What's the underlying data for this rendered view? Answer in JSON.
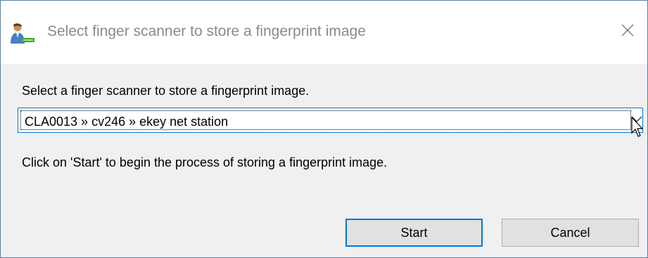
{
  "window": {
    "title": "Select finger scanner to store a fingerprint image",
    "app_icon": "user-scanner-icon",
    "close_icon": "close-icon"
  },
  "dialog": {
    "instruction": "Select a finger scanner to store a fingerprint image.",
    "scanner_select": {
      "selected_value": "CLA0013 » cv246 » ekey net station",
      "arrow_icon": "chevron-down-icon"
    },
    "hint": "Click on 'Start' to begin the process of storing a fingerprint image.",
    "buttons": {
      "start_label": "Start",
      "cancel_label": "Cancel"
    }
  },
  "colors": {
    "accent": "#0078d7",
    "dialog_background": "#f0f0f0",
    "button_background": "#e1e1e1",
    "title_text": "#8a8a8a"
  }
}
